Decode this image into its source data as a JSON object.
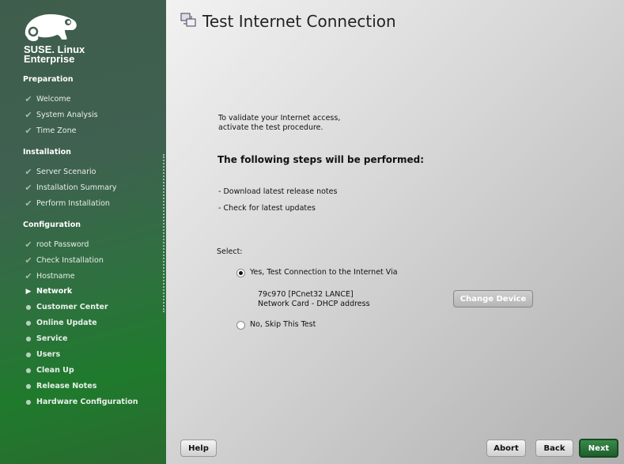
{
  "brand": {
    "line1": "SUSE. Linux",
    "line2": "Enterprise"
  },
  "sidebar": {
    "sections": [
      {
        "label": "Preparation",
        "items": [
          {
            "label": "Welcome",
            "state": "done"
          },
          {
            "label": "System Analysis",
            "state": "done"
          },
          {
            "label": "Time Zone",
            "state": "done"
          }
        ]
      },
      {
        "label": "Installation",
        "items": [
          {
            "label": "Server Scenario",
            "state": "done"
          },
          {
            "label": "Installation Summary",
            "state": "done"
          },
          {
            "label": "Perform Installation",
            "state": "done"
          }
        ]
      },
      {
        "label": "Configuration",
        "items": [
          {
            "label": "root Password",
            "state": "done"
          },
          {
            "label": "Check Installation",
            "state": "done"
          },
          {
            "label": "Hostname",
            "state": "done"
          },
          {
            "label": "Network",
            "state": "current"
          },
          {
            "label": "Customer Center",
            "state": "todo"
          },
          {
            "label": "Online Update",
            "state": "todo"
          },
          {
            "label": "Service",
            "state": "todo"
          },
          {
            "label": "Users",
            "state": "todo"
          },
          {
            "label": "Clean Up",
            "state": "todo"
          },
          {
            "label": "Release Notes",
            "state": "todo"
          },
          {
            "label": "Hardware Configuration",
            "state": "todo"
          }
        ]
      }
    ]
  },
  "main": {
    "title": "Test Internet Connection",
    "intro1": "To validate your Internet access,",
    "intro2": "activate the test procedure.",
    "steps_heading": "The following steps will be performed:",
    "step1": "- Download latest release notes",
    "step2": "- Check for latest updates",
    "select_label": "Select:",
    "option_yes": "Yes, Test Connection to the Internet Via",
    "option_no": "No, Skip This Test",
    "device_name": "79c970 [PCnet32 LANCE]",
    "device_desc": "Network Card - DHCP address",
    "change_device": "Change Device",
    "selected": "yes"
  },
  "buttons": {
    "help": "Help",
    "abort": "Abort",
    "back": "Back",
    "next": "Next"
  }
}
